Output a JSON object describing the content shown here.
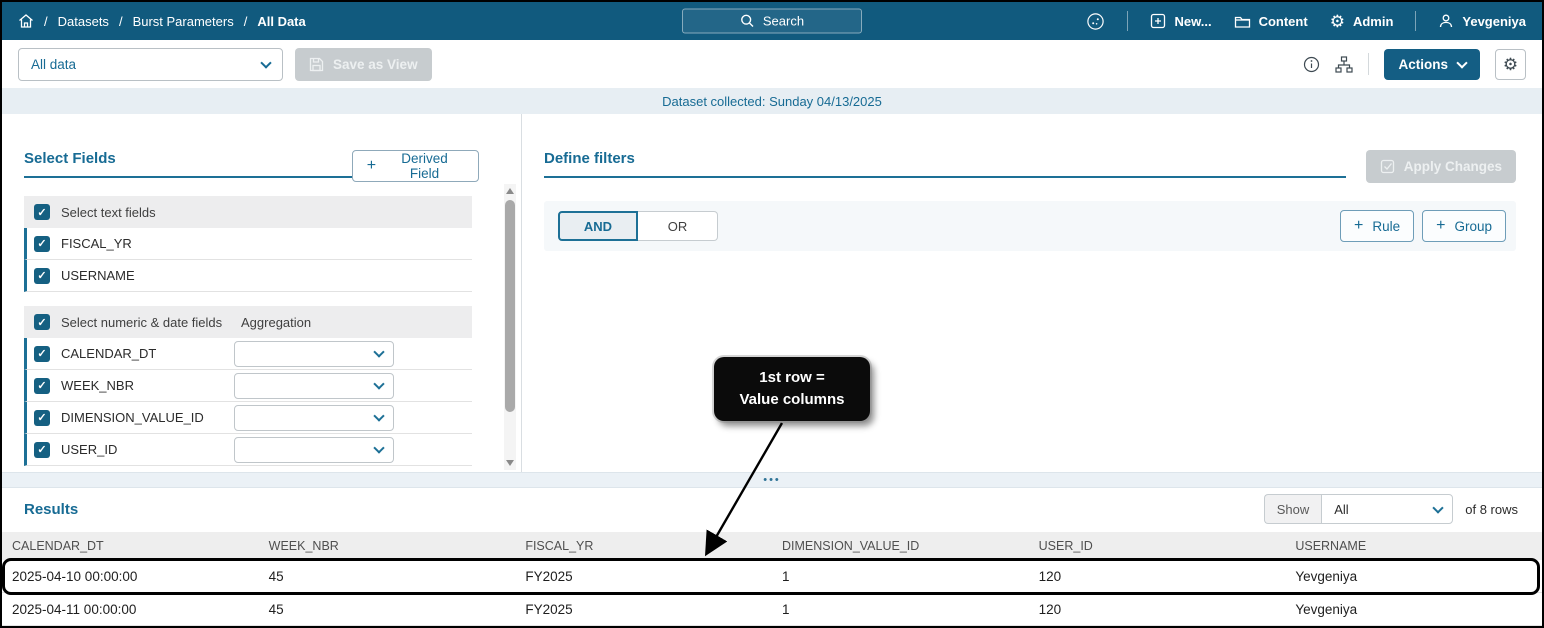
{
  "navbar": {
    "breadcrumb": {
      "separator": "/",
      "items": [
        "Datasets",
        "Burst Parameters",
        "All Data"
      ]
    },
    "search_label": "Search",
    "new_label": "New...",
    "content_label": "Content",
    "admin_label": "Admin",
    "user_name": "Yevgeniya"
  },
  "toolbar": {
    "view_select_value": "All data",
    "save_as_view_label": "Save as View",
    "actions_label": "Actions"
  },
  "banner": {
    "text": "Dataset collected: Sunday 04/13/2025"
  },
  "select_fields": {
    "heading": "Select Fields",
    "derived_field_label": "Derived Field",
    "text_group": {
      "label": "Select text fields",
      "items": [
        "FISCAL_YR",
        "USERNAME"
      ]
    },
    "numeric_group": {
      "label": "Select numeric & date fields",
      "aggregation_label": "Aggregation",
      "items": [
        "CALENDAR_DT",
        "WEEK_NBR",
        "DIMENSION_VALUE_ID",
        "USER_ID"
      ]
    }
  },
  "filters": {
    "heading": "Define filters",
    "apply_label": "Apply Changes",
    "and_label": "AND",
    "or_label": "OR",
    "rule_label": "Rule",
    "group_label": "Group"
  },
  "annotation": {
    "line1": "1st row =",
    "line2": "Value columns"
  },
  "results": {
    "heading": "Results",
    "show_label": "Show",
    "show_value": "All",
    "rows_info": "of 8 rows",
    "table": {
      "columns": [
        "CALENDAR_DT",
        "WEEK_NBR",
        "FISCAL_YR",
        "DIMENSION_VALUE_ID",
        "USER_ID",
        "USERNAME"
      ],
      "rows": [
        [
          "2025-04-10 00:00:00",
          "45",
          "FY2025",
          "1",
          "120",
          "Yevgeniya"
        ],
        [
          "2025-04-11 00:00:00",
          "45",
          "FY2025",
          "1",
          "120",
          "Yevgeniya"
        ]
      ]
    }
  },
  "icons": {
    "plus": "+",
    "check": "✓",
    "gear": "⚙",
    "dots": "•••"
  },
  "colors": {
    "navbar_bg": "#115A7E",
    "accent": "#176B94",
    "banner_bg": "#E7EEF3",
    "disabled_bg": "#C7CCCF",
    "checkbox_bg": "#156082",
    "highlight_border": "#000000"
  }
}
